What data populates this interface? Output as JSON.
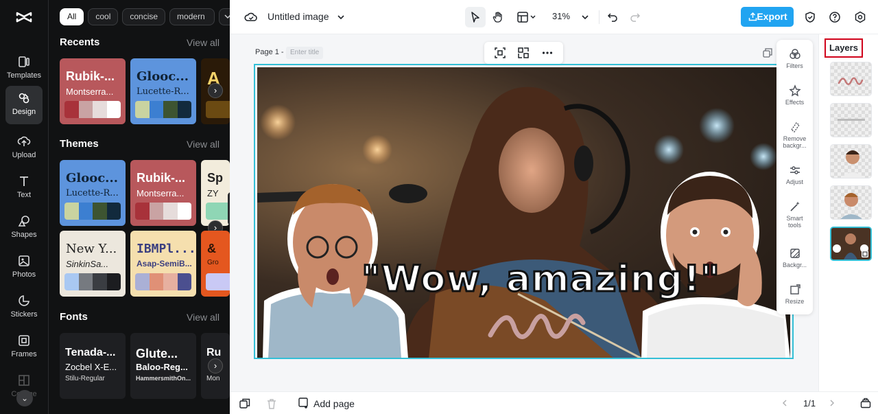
{
  "rail": {
    "items": [
      {
        "label": "Templates"
      },
      {
        "label": "Design"
      },
      {
        "label": "Upload"
      },
      {
        "label": "Text"
      },
      {
        "label": "Shapes"
      },
      {
        "label": "Photos"
      },
      {
        "label": "Stickers"
      },
      {
        "label": "Frames"
      },
      {
        "label": "Collage"
      }
    ]
  },
  "panel": {
    "chips": [
      "All",
      "cool",
      "concise",
      "modern"
    ],
    "recents": {
      "title": "Recents",
      "view_all": "View all",
      "cards": [
        {
          "t1": "Rubik-...",
          "t2": "Montserra...",
          "colors": [
            "#a8323a",
            "#c9a3a3",
            "#e6dcdb",
            "#ffffff"
          ],
          "bg": "#b8585c",
          "fg": "#ffffff"
        },
        {
          "t1": "Glooc...",
          "t2": "Lucette-R...",
          "colors": [
            "#c9d3a0",
            "#3c7fd1",
            "#3d5431",
            "#122a3d"
          ],
          "bg": "#5d94dd",
          "fg": "#102235"
        },
        {
          "t1": "A",
          "t2": "",
          "colors": [
            "#6b4a12",
            "#6b4a12",
            "#6b4a12",
            "#6b4a12"
          ],
          "bg": "#2a1a08",
          "fg": "#f5d36a"
        }
      ]
    },
    "themes": {
      "title": "Themes",
      "view_all": "View all",
      "cards": [
        {
          "t1": "Glooc...",
          "t2": "Lucette-R...",
          "colors": [
            "#c9d3a0",
            "#3c7fd1",
            "#3d5431",
            "#122a3d"
          ],
          "bg": "#5d94dd",
          "fg": "#102235"
        },
        {
          "t1": "Rubik-...",
          "t2": "Montserra...",
          "colors": [
            "#a8323a",
            "#c9a3a3",
            "#e6dcdb",
            "#ffffff"
          ],
          "bg": "#b8585c",
          "fg": "#ffffff"
        },
        {
          "t1": "Sp",
          "t2": "ZY",
          "colors": [
            "#8fd6b5",
            "#8fd6b5",
            "#8fd6b5",
            "#8fd6b5"
          ],
          "bg": "#f2ecdc",
          "fg": "#222"
        },
        {
          "t1": "New Y...",
          "t2": "SinkinSa...",
          "colors": [
            "#a9c8f2",
            "#767a80",
            "#3a3d42",
            "#1c1d20"
          ],
          "bg": "#ece7dd",
          "fg": "#222"
        },
        {
          "t1": "IBMPl...",
          "t2": "Asap-SemiB...",
          "colors": [
            "#aab0d6",
            "#e09076",
            "#e7b0a0",
            "#4b4f8f"
          ],
          "bg": "#f5dfae",
          "fg": "#3b3f80"
        },
        {
          "t1": "&",
          "t2": "Gro",
          "colors": [
            "#c9c9f5",
            "#c9c9f5",
            "#c9c9f5",
            "#c9c9f5"
          ],
          "bg": "#e4571f",
          "fg": "#2a1408"
        }
      ]
    },
    "fonts": {
      "title": "Fonts",
      "view_all": "View all",
      "cards": [
        {
          "f1": "Tenada-...",
          "f2": "Zocbel X-E...",
          "f3": "Stilu-Regular"
        },
        {
          "f1": "Glute...",
          "f2": "Baloo-Reg...",
          "f3": "HammersmithOn..."
        },
        {
          "f1": "Ru",
          "f2": "",
          "f3": "Mon"
        }
      ]
    }
  },
  "topbar": {
    "title": "Untitled image",
    "zoom": "31%",
    "export": "Export"
  },
  "workspace": {
    "page_label": "Page 1 -",
    "title_placeholder": "Enter title",
    "headline": "\"Wow, amazing!\""
  },
  "tools": [
    {
      "label": "Filters"
    },
    {
      "label": "Effects"
    },
    {
      "label": "Remove backgr..."
    },
    {
      "label": "Adjust"
    },
    {
      "label": "Smart tools"
    },
    {
      "label": "Backgr..."
    },
    {
      "label": "Resize"
    }
  ],
  "layers": {
    "title": "Layers"
  },
  "bottombar": {
    "add_page": "Add page",
    "page_counter": "1/1"
  }
}
